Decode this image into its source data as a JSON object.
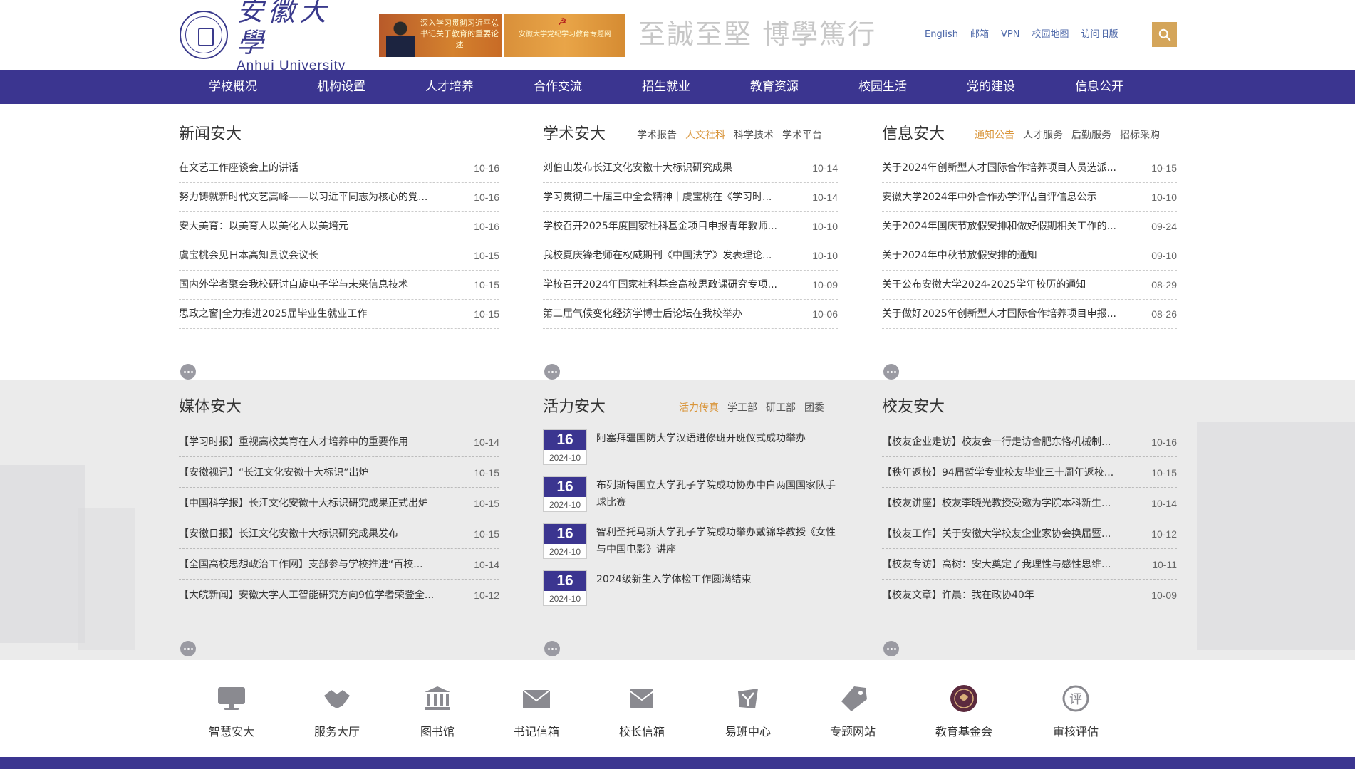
{
  "header": {
    "logo_cn": "安徽大學",
    "logo_en": "Anhui University",
    "banner1_text": "深入学习贯彻习近平总书记关于教育的重要论述",
    "banner2_text": "安徽大学党纪学习教育专题网",
    "motto": "至誠至堅 博學篤行",
    "top_links": [
      "English",
      "邮箱",
      "VPN",
      "校园地图",
      "访问旧版"
    ]
  },
  "nav": [
    "学校概况",
    "机构设置",
    "人才培养",
    "合作交流",
    "招生就业",
    "教育资源",
    "校园生活",
    "党的建设",
    "信息公开"
  ],
  "news": {
    "title": "新闻安大",
    "items": [
      {
        "t": "在文艺工作座谈会上的讲话",
        "d": "10-16"
      },
      {
        "t": "努力铸就新时代文艺高峰——以习近平同志为核心的党...",
        "d": "10-16"
      },
      {
        "t": "安大美育：以美育人以美化人以美培元",
        "d": "10-16"
      },
      {
        "t": "虞宝桃会见日本高知县议会议长",
        "d": "10-15"
      },
      {
        "t": "国内外学者聚会我校研讨自旋电子学与未来信息技术",
        "d": "10-15"
      },
      {
        "t": "思政之窗|全力推进2025届毕业生就业工作",
        "d": "10-15"
      }
    ]
  },
  "academic": {
    "title": "学术安大",
    "tabs": [
      "学术报告",
      "人文社科",
      "科学技术",
      "学术平台"
    ],
    "items": [
      {
        "t": "刘伯山发布长江文化安徽十大标识研究成果",
        "d": "10-14"
      },
      {
        "t": "学习贯彻二十届三中全会精神｜虞宝桃在《学习时...",
        "d": "10-14"
      },
      {
        "t": "学校召开2025年度国家社科基金项目申报青年教师...",
        "d": "10-10"
      },
      {
        "t": "我校夏庆锋老师在权威期刊《中国法学》发表理论...",
        "d": "10-10"
      },
      {
        "t": "学校召开2024年国家社科基金高校思政课研究专项...",
        "d": "10-09"
      },
      {
        "t": "第二届气候变化经济学博士后论坛在我校举办",
        "d": "10-06"
      }
    ]
  },
  "info": {
    "title": "信息安大",
    "tabs": [
      "通知公告",
      "人才服务",
      "后勤服务",
      "招标采购"
    ],
    "items": [
      {
        "t": "关于2024年创新型人才国际合作培养项目人员选派...",
        "d": "10-15"
      },
      {
        "t": "安徽大学2024年中外合作办学评估自评信息公示",
        "d": "10-10"
      },
      {
        "t": "关于2024年国庆节放假安排和做好假期相关工作的...",
        "d": "09-24"
      },
      {
        "t": "关于2024年中秋节放假安排的通知",
        "d": "09-10"
      },
      {
        "t": "关于公布安徽大学2024-2025学年校历的通知",
        "d": "08-29"
      },
      {
        "t": "关于做好2025年创新型人才国际合作培养项目申报...",
        "d": "08-26"
      }
    ]
  },
  "media": {
    "title": "媒体安大",
    "items": [
      {
        "t": "【学习时报】重视高校美育在人才培养中的重要作用",
        "d": "10-14"
      },
      {
        "t": "【安徽视讯】“长江文化安徽十大标识”出炉",
        "d": "10-15"
      },
      {
        "t": "【中国科学报】长江文化安徽十大标识研究成果正式出炉",
        "d": "10-15"
      },
      {
        "t": "【安徽日报】长江文化安徽十大标识研究成果发布",
        "d": "10-15"
      },
      {
        "t": "【全国高校思想政治工作网】支部参与学校推进“百校...",
        "d": "10-14"
      },
      {
        "t": "【大皖新闻】安徽大学人工智能研究方向9位学者荣登全...",
        "d": "10-12"
      }
    ]
  },
  "vitality": {
    "title": "活力安大",
    "tabs": [
      "活力传真",
      "学工部",
      "研工部",
      "团委"
    ],
    "items": [
      {
        "day": "16",
        "ym": "2024-10",
        "t": "阿塞拜疆国防大学汉语进修班开班仪式成功举办"
      },
      {
        "day": "16",
        "ym": "2024-10",
        "t": "布列斯特国立大学孔子学院成功协办中白两国国家队手球比赛"
      },
      {
        "day": "16",
        "ym": "2024-10",
        "t": "智利圣托马斯大学孔子学院成功举办戴锦华教授《女性与中国电影》讲座"
      },
      {
        "day": "16",
        "ym": "2024-10",
        "t": "2024级新生入学体检工作圆满结束"
      }
    ]
  },
  "alumni": {
    "title": "校友安大",
    "items": [
      {
        "t": "【校友企业走访】校友会一行走访合肥东恪机械制...",
        "d": "10-16"
      },
      {
        "t": "【秩年返校】94届哲学专业校友毕业三十周年返校...",
        "d": "10-15"
      },
      {
        "t": "【校友讲座】校友李晓光教授受邀为学院本科新生...",
        "d": "10-14"
      },
      {
        "t": "【校友工作】关于安徽大学校友企业家协会换届暨...",
        "d": "10-12"
      },
      {
        "t": "【校友专访】高树：安大奠定了我理性与感性思维...",
        "d": "10-11"
      },
      {
        "t": "【校友文章】许晨：我在政协40年",
        "d": "10-09"
      }
    ]
  },
  "quick_links": [
    {
      "label": "智慧安大",
      "icon": "monitor-icon"
    },
    {
      "label": "服务大厅",
      "icon": "handshake-icon"
    },
    {
      "label": "图书馆",
      "icon": "library-icon"
    },
    {
      "label": "书记信箱",
      "icon": "envelope-icon"
    },
    {
      "label": "校长信箱",
      "icon": "mail-icon"
    },
    {
      "label": "易班中心",
      "icon": "yiban-icon"
    },
    {
      "label": "专题网站",
      "icon": "tag-icon"
    },
    {
      "label": "教育基金会",
      "icon": "foundation-icon"
    },
    {
      "label": "审核评估",
      "icon": "review-icon"
    }
  ],
  "colors": {
    "nav": "#3b3590",
    "accent": "#d9953a",
    "search": "#d4a55a"
  }
}
